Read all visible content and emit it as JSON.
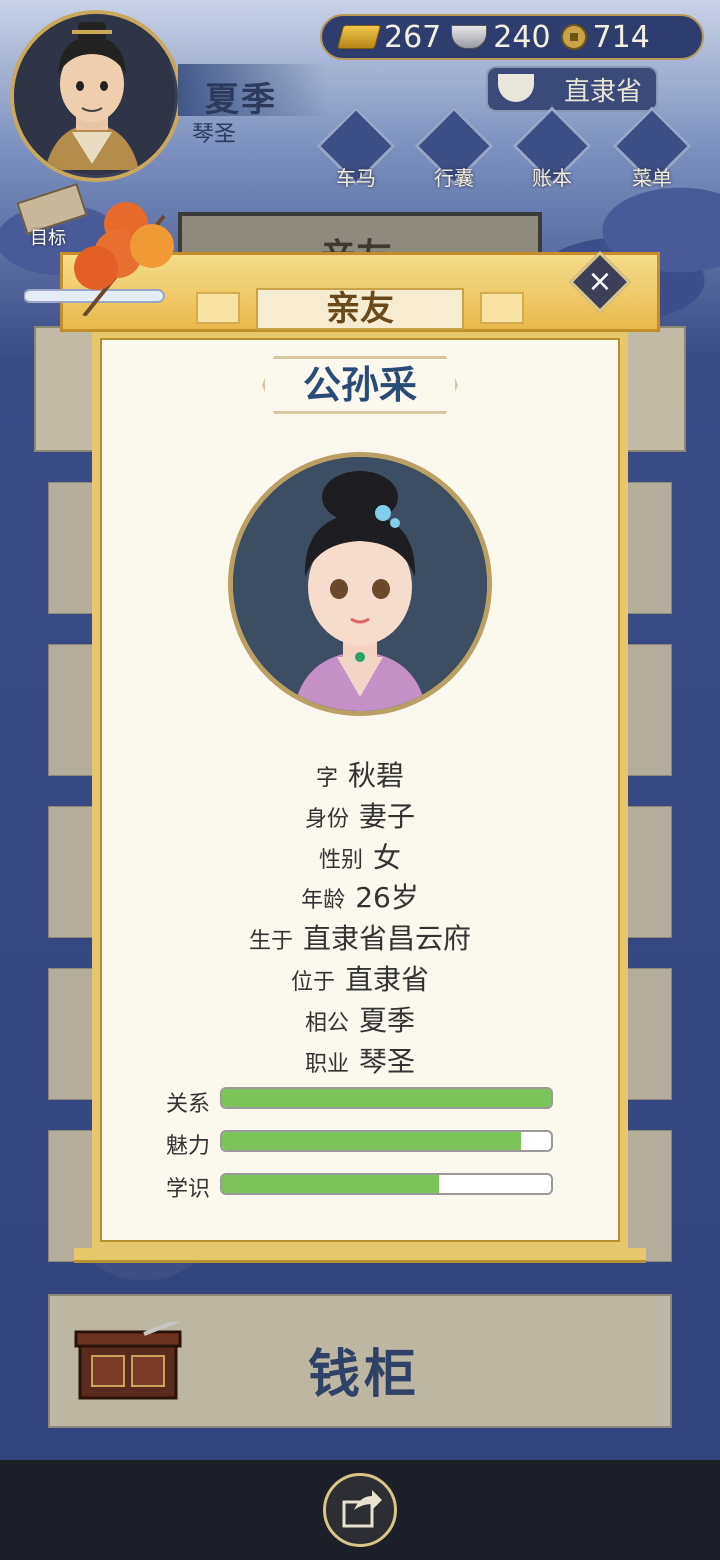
{
  "player": {
    "name": "夏季",
    "title": "琴圣"
  },
  "currency": {
    "gold": "267",
    "silver": "240",
    "coins": "714"
  },
  "location": "直隶省",
  "menu": {
    "carriage": "车马",
    "bag": "行囊",
    "ledger": "账本",
    "menu": "菜单",
    "goal": "目标"
  },
  "background_tab": "亲友",
  "modal": {
    "title": "亲友",
    "close": "×",
    "character_name": "公孙采",
    "info": [
      {
        "key": "字",
        "value": "秋碧"
      },
      {
        "key": "身份",
        "value": "妻子"
      },
      {
        "key": "性别",
        "value": "女"
      },
      {
        "key": "年龄",
        "value": "26岁"
      },
      {
        "key": "生于",
        "value": "直隶省昌云府"
      },
      {
        "key": "位于",
        "value": "直隶省"
      },
      {
        "key": "相公",
        "value": "夏季"
      },
      {
        "key": "职业",
        "value": "琴圣"
      }
    ],
    "stats": [
      {
        "label": "关系",
        "fraction": 1.0
      },
      {
        "label": "魅力",
        "fraction": 0.91
      },
      {
        "label": "学识",
        "fraction": 0.66
      }
    ]
  },
  "chest": {
    "label": "钱柜"
  },
  "colors": {
    "accent_gold": "#e6c76c",
    "bar_green": "#7cc35a",
    "title_blue": "#2a4a78"
  }
}
